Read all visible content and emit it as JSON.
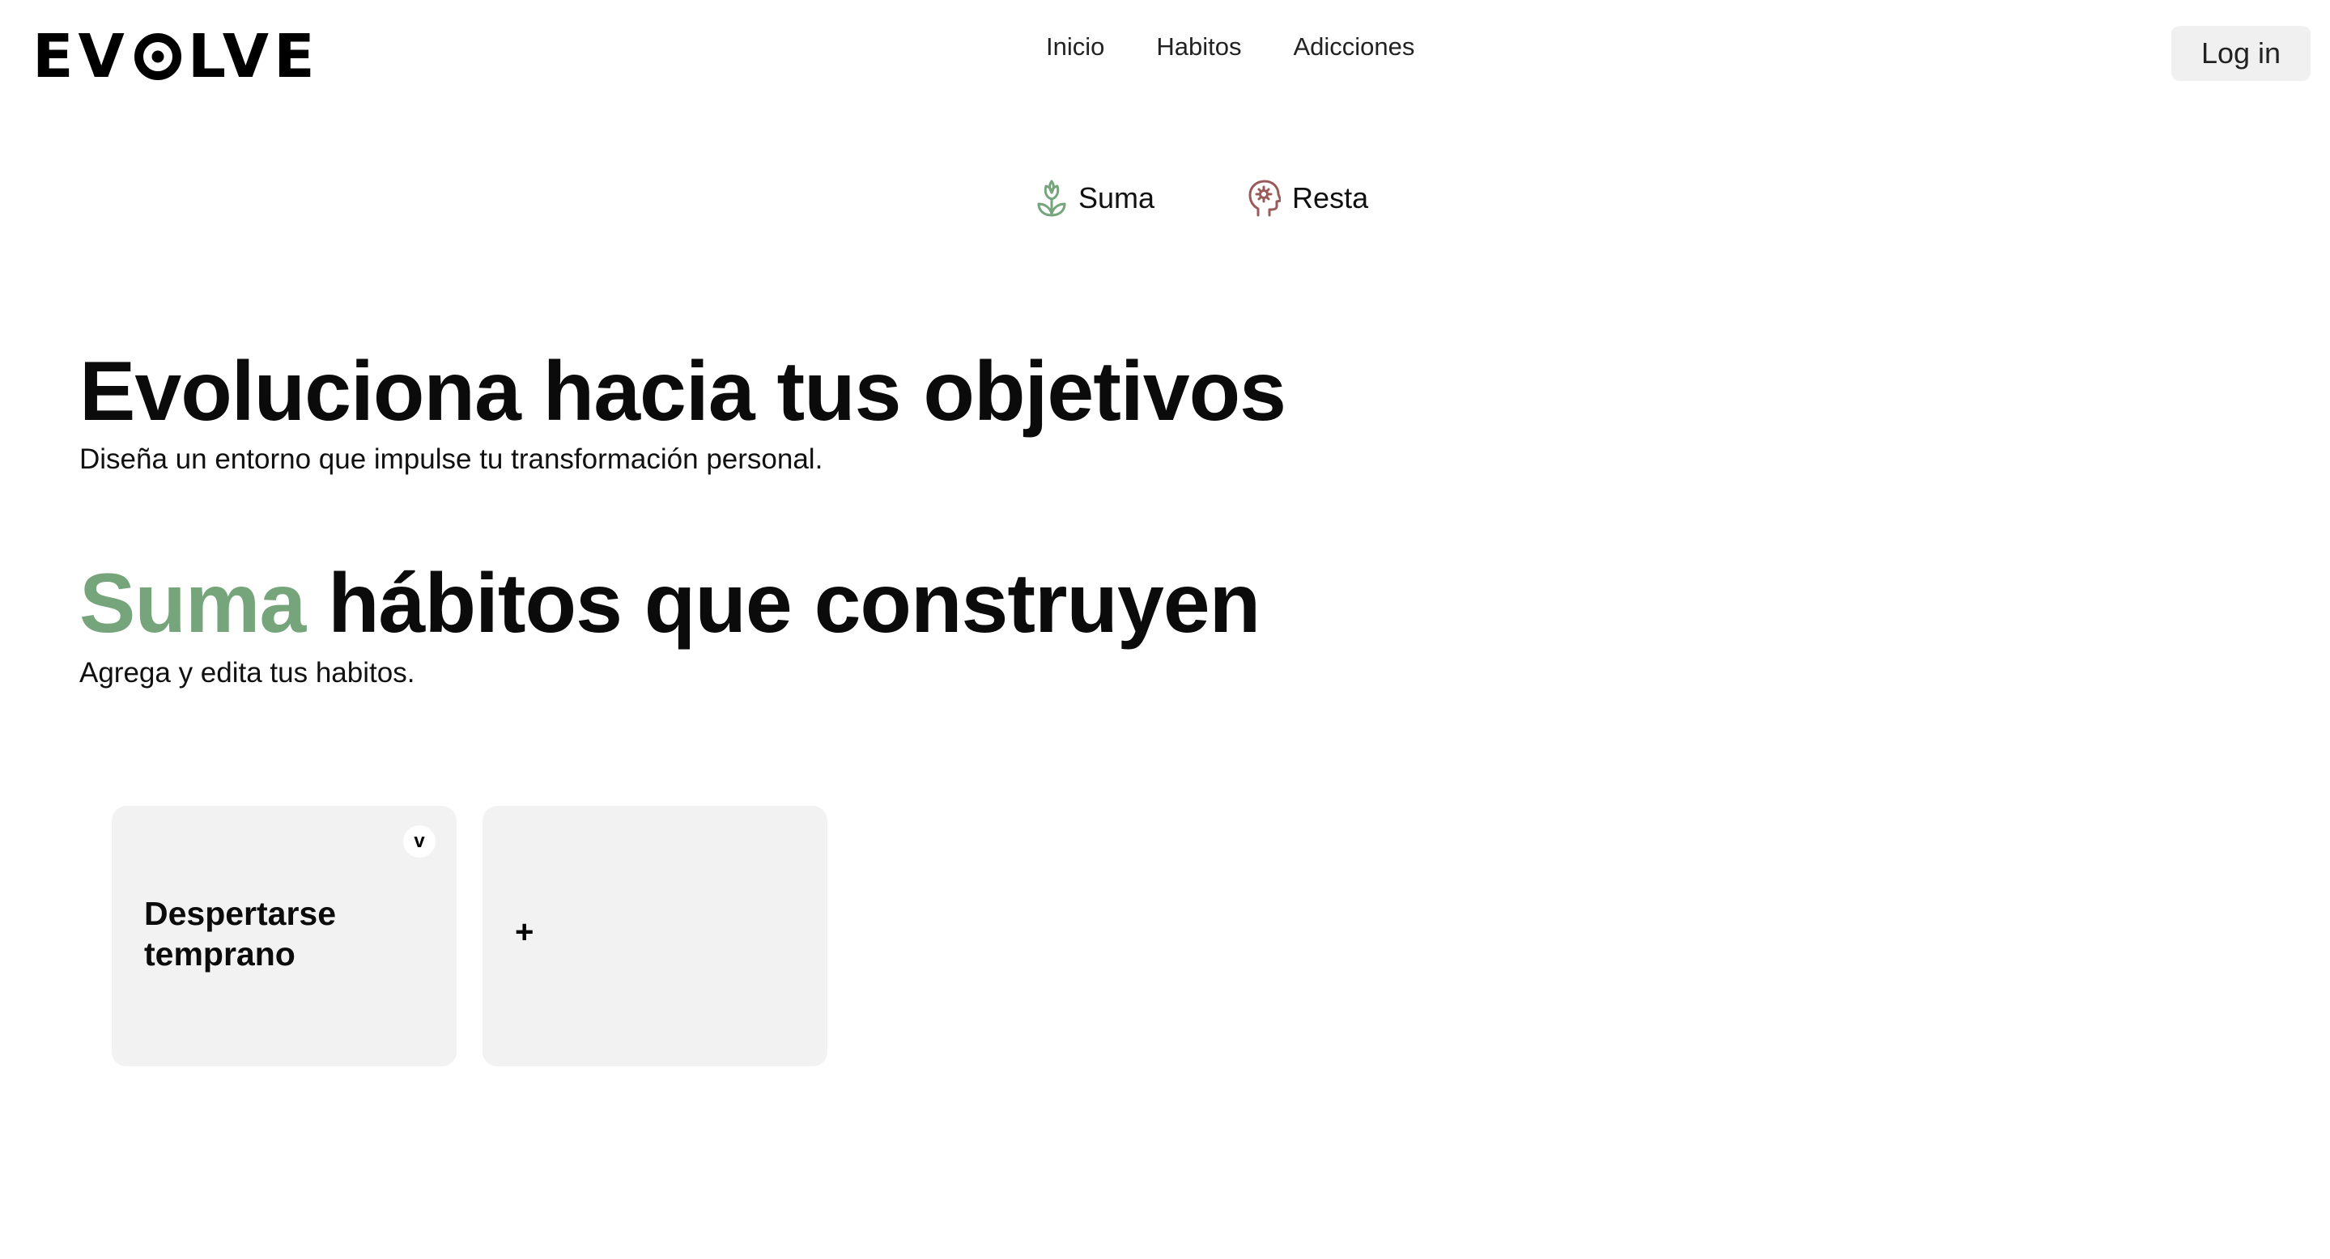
{
  "brand": {
    "logo_text": "EVOLVE",
    "logo_part1": "EV",
    "logo_part2": "LVE"
  },
  "nav": {
    "items": [
      {
        "label": "Inicio"
      },
      {
        "label": "Habitos"
      },
      {
        "label": "Adicciones"
      }
    ],
    "login_label": "Log in"
  },
  "modes": {
    "suma": {
      "label": "Suma",
      "icon": "plant-icon",
      "color": "#76a57c"
    },
    "resta": {
      "label": "Resta",
      "icon": "head-gear-icon",
      "color": "#9a5a5a"
    }
  },
  "hero": {
    "title": "Evoluciona hacia tus objetivos",
    "subtitle": "Diseña un entorno que impulse tu transformación personal."
  },
  "section": {
    "title_accent": "Suma",
    "title_rest": " hábitos que construyen",
    "accent_color": "#76a57c",
    "subtitle": "Agrega y edita tus habitos."
  },
  "cards": {
    "habit": {
      "name": "Despertarse temprano",
      "toggle_label": "v"
    },
    "add": {
      "label": "+"
    }
  }
}
